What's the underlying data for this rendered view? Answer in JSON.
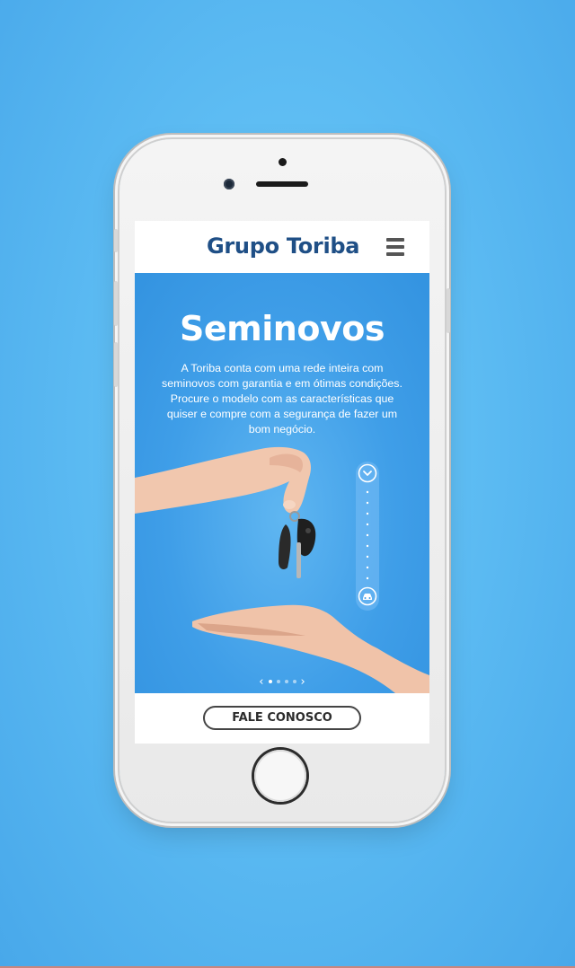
{
  "app": {
    "brand": "Grupo Toriba",
    "menu_icon": "hamburger-menu-icon"
  },
  "hero": {
    "title": "Seminovos",
    "description": "A Toriba conta com uma rede inteira com seminovos com garantia e em ótimas condições. Procure o modelo com as características que quiser e compre com a segurança de fazer um bom negócio.",
    "scroll_icons": [
      "chevron-down-icon",
      "car-icon"
    ]
  },
  "carousel": {
    "prev_label": "‹",
    "next_label": "›",
    "slide_count": 4,
    "active_index": 0
  },
  "cta": {
    "label": "FALE CONOSCO"
  },
  "colors": {
    "background": "#5dbcf3",
    "brand": "#1f4f86",
    "hero": "#3f9ee8"
  }
}
